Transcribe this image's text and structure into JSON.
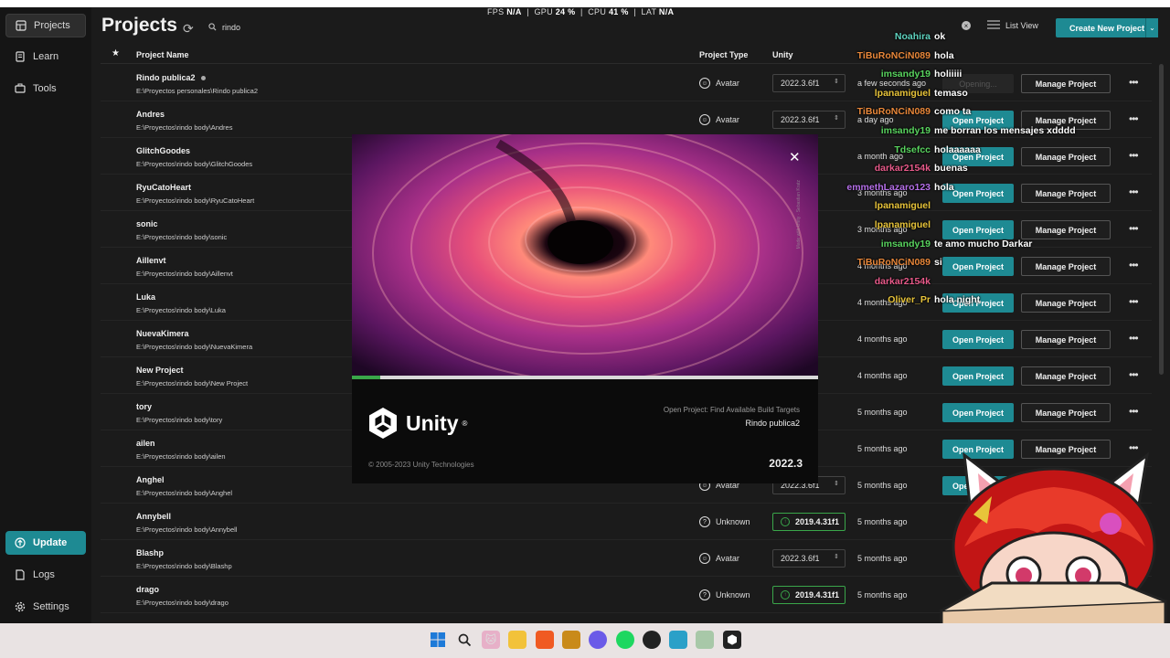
{
  "sidebar": {
    "items": [
      {
        "label": "Projects",
        "icon": "projects-icon"
      },
      {
        "label": "Learn",
        "icon": "learn-icon"
      },
      {
        "label": "Tools",
        "icon": "tools-icon"
      }
    ],
    "bottom": [
      {
        "label": "Update",
        "icon": "update-icon"
      },
      {
        "label": "Logs",
        "icon": "logs-icon"
      },
      {
        "label": "Settings",
        "icon": "gear-icon"
      }
    ]
  },
  "header": {
    "title": "Projects",
    "search_value": "rindo",
    "list_view_label": "List View",
    "create_label": "Create New Project"
  },
  "perf": {
    "fps_label": "FPS",
    "fps": "N/A",
    "gpu_label": "GPU",
    "gpu": "24 %",
    "cpu_label": "CPU",
    "cpu": "41 %",
    "lat_label": "LAT",
    "lat": "N/A"
  },
  "table": {
    "headers": {
      "name": "Project Name",
      "type": "Project Type",
      "unity": "Unity"
    },
    "rows": [
      {
        "name": "Rindo publica2",
        "path": "E:\\Proyectos personales\\Rindo publica2",
        "type": "Avatar",
        "version": "2022.3.6f1",
        "date": "a few seconds ago",
        "open": "Opening...",
        "manage": "Manage Project"
      },
      {
        "name": "Andres",
        "path": "E:\\Proyectos\\rindo body\\Andres",
        "type": "Avatar",
        "version": "2022.3.6f1",
        "date": "a day ago",
        "open": "Open Project",
        "manage": "Manage Project"
      },
      {
        "name": "GlitchGoodes",
        "path": "E:\\Proyectos\\rindo body\\GlitchGoodes",
        "type": "",
        "version": "f1",
        "date": "a month ago",
        "open": "Open Project",
        "manage": "Manage Project"
      },
      {
        "name": "RyuCatoHeart",
        "path": "E:\\Proyectos\\rindo body\\RyuCatoHeart",
        "type": "",
        "version": ".31f1",
        "date": "3 months ago",
        "open": "Open Project",
        "manage": "Manage Project"
      },
      {
        "name": "sonic",
        "path": "E:\\Proyectos\\rindo body\\sonic",
        "type": "",
        "version": ".31f1",
        "date": "3 months ago",
        "open": "Open Project",
        "manage": "Manage Project"
      },
      {
        "name": "Aillenvt",
        "path": "E:\\Proyectos\\rindo body\\Aillenvt",
        "type": "",
        "version": "f1",
        "date": "4 months ago",
        "open": "Open Project",
        "manage": "Manage Project"
      },
      {
        "name": "Luka",
        "path": "E:\\Proyectos\\rindo body\\Luka",
        "type": "",
        "version": ".31f1",
        "date": "4 months ago",
        "open": "Open Project",
        "manage": "Manage Project"
      },
      {
        "name": "NuevaKimera",
        "path": "E:\\Proyectos\\rindo body\\NuevaKimera",
        "type": "",
        "version": "",
        "date": "4 months ago",
        "open": "Open Project",
        "manage": "Manage Project"
      },
      {
        "name": "New Project",
        "path": "E:\\Proyectos\\rindo body\\New Project",
        "type": "",
        "version": "",
        "date": "4 months ago",
        "open": "Open Project",
        "manage": "Manage Project"
      },
      {
        "name": "tory",
        "path": "E:\\Proyectos\\rindo body\\tory",
        "type": "",
        "version": "",
        "date": "5 months ago",
        "open": "Open Project",
        "manage": "Manage Project"
      },
      {
        "name": "ailen",
        "path": "E:\\Proyectos\\rindo body\\ailen",
        "type": "",
        "version": ".31f1",
        "date": "5 months ago",
        "open": "Open Project",
        "manage": "Manage Project"
      },
      {
        "name": "Anghel",
        "path": "E:\\Proyectos\\rindo body\\Anghel",
        "type": "Avatar",
        "version": "2022.3.6f1",
        "date": "5 months ago",
        "open": "Open Project",
        "manage": ""
      },
      {
        "name": "Annybell",
        "path": "E:\\Proyectos\\rindo body\\Annybell",
        "type": "Unknown",
        "version": "2019.4.31f1",
        "date": "5 months ago",
        "open": "",
        "manage": ""
      },
      {
        "name": "Blashp",
        "path": "E:\\Proyectos\\rindo body\\Blashp",
        "type": "Avatar",
        "version": "2022.3.6f1",
        "date": "5 months ago",
        "open": "",
        "manage": ""
      },
      {
        "name": "drago",
        "path": "E:\\Proyectos\\rindo body\\drago",
        "type": "Unknown",
        "version": "2019.4.31f1",
        "date": "5 months ago",
        "open": "",
        "manage": ""
      }
    ]
  },
  "splash": {
    "brand": "Unity",
    "task": "Open Project:  Find Available Build Targets",
    "project": "Rindo publica2",
    "copyright": "© 2005-2023 Unity Technologies",
    "version": "2022.3",
    "progress": 0.06,
    "credit": "Made with Unity · Sebastian Kratz"
  },
  "chat": [
    {
      "user": "Noahira",
      "text": "ok",
      "color": "#5fd4c0"
    },
    {
      "user": "TiBuRoNCiN089",
      "text": "hola",
      "color": "#e8873a"
    },
    {
      "user": "imsandy19",
      "text": "holiiiii",
      "color": "#59d45f"
    },
    {
      "user": "lpanamiguel",
      "text": "temaso",
      "color": "#e8c43a"
    },
    {
      "user": "TiBuRoNCiN089",
      "text": "como ta",
      "color": "#e8873a"
    },
    {
      "user": "imsandy19",
      "text": "me borran los mensajes xdddd",
      "color": "#59d45f"
    },
    {
      "user": "Tdsefcc",
      "text": "holaaaaaa",
      "color": "#59d45f"
    },
    {
      "user": "darkar2154k",
      "text": "buenas",
      "color": "#e85a8a"
    },
    {
      "user": "emmethLazaro123",
      "text": "hola",
      "color": "#b56fe8"
    },
    {
      "user": "lpanamiguel",
      "text": "",
      "color": "#e8c43a"
    },
    {
      "user": "lpanamiguel",
      "text": "",
      "color": "#e8c43a"
    },
    {
      "user": "imsandy19",
      "text": "te amo mucho Darkar",
      "color": "#59d45f"
    },
    {
      "user": "TiBuRoNCiN089",
      "text": "si",
      "color": "#e8873a"
    },
    {
      "user": "darkar2154k",
      "text": "",
      "color": "#e85a8a"
    },
    {
      "user": "Oliver_Pr",
      "text": "hola night",
      "color": "#e8c43a"
    }
  ],
  "colors": {
    "accent": "#1e8a93",
    "update_green": "#3aa64a",
    "bg": "#1b1b1b",
    "sidebar": "#151515"
  }
}
